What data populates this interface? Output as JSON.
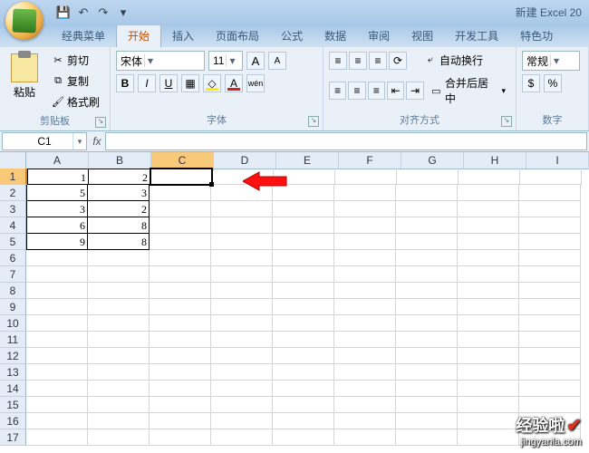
{
  "window": {
    "title": "新建 Excel 20"
  },
  "qat_icons": [
    "save-icon",
    "undo-icon",
    "redo-icon",
    "qat-more-icon"
  ],
  "tabs": [
    {
      "label": "经典菜单",
      "active": false
    },
    {
      "label": "开始",
      "active": true
    },
    {
      "label": "插入",
      "active": false
    },
    {
      "label": "页面布局",
      "active": false
    },
    {
      "label": "公式",
      "active": false
    },
    {
      "label": "数据",
      "active": false
    },
    {
      "label": "审阅",
      "active": false
    },
    {
      "label": "视图",
      "active": false
    },
    {
      "label": "开发工具",
      "active": false
    },
    {
      "label": "特色功",
      "active": false
    }
  ],
  "ribbon": {
    "clipboard": {
      "title": "剪贴板",
      "paste": "粘贴",
      "cut": "剪切",
      "copy": "复制",
      "format_painter": "格式刷"
    },
    "font": {
      "title": "字体",
      "name": "宋体",
      "size": "11"
    },
    "alignment": {
      "title": "对齐方式",
      "wrap": "自动换行",
      "merge": "合并后居中"
    },
    "number": {
      "title": "数字",
      "format": "常规",
      "percent": "%"
    }
  },
  "namebox": "C1",
  "formula": "",
  "columns": [
    "A",
    "B",
    "C",
    "D",
    "E",
    "F",
    "G",
    "H",
    "I"
  ],
  "rows": [
    "1",
    "2",
    "3",
    "4",
    "5",
    "6",
    "7",
    "8",
    "9",
    "10",
    "11",
    "12",
    "13",
    "14",
    "15",
    "16",
    "17"
  ],
  "active_cell": {
    "row": 0,
    "col": 2
  },
  "data": [
    [
      "1",
      "2",
      "",
      "",
      "",
      "",
      "",
      "",
      ""
    ],
    [
      "5",
      "3",
      "",
      "",
      "",
      "",
      "",
      "",
      ""
    ],
    [
      "3",
      "2",
      "",
      "",
      "",
      "",
      "",
      "",
      ""
    ],
    [
      "6",
      "8",
      "",
      "",
      "",
      "",
      "",
      "",
      ""
    ],
    [
      "9",
      "8",
      "",
      "",
      "",
      "",
      "",
      "",
      ""
    ]
  ],
  "bordered_region": {
    "rows": [
      0,
      4
    ],
    "cols": [
      0,
      1
    ]
  },
  "watermark": {
    "top": "经验啦",
    "bottom": "jingyanla.com"
  }
}
